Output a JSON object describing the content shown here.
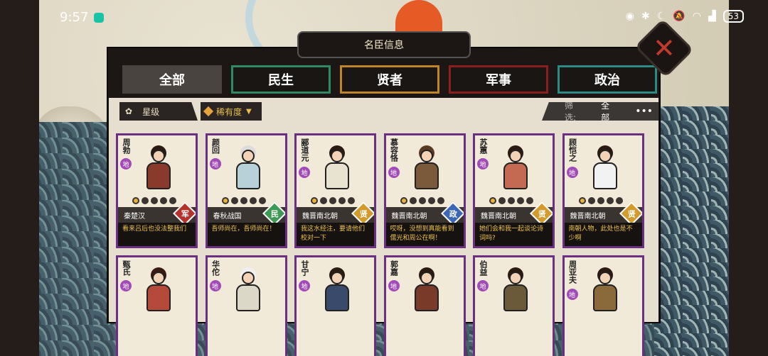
{
  "status_bar": {
    "time": "9:57",
    "battery": "53"
  },
  "window": {
    "title": "名臣信息"
  },
  "tabs": [
    {
      "label": "全部",
      "active": true
    },
    {
      "label": "民生"
    },
    {
      "label": "贤者"
    },
    {
      "label": "军事"
    },
    {
      "label": "政治"
    }
  ],
  "filters": {
    "star_label": "星级",
    "rarity_label": "稀有度",
    "screen_label": "筛选:",
    "screen_value": "全部",
    "more": "•••"
  },
  "cards": [
    {
      "name": "周勃",
      "tier": "地",
      "era": "秦楚汉",
      "category": "军",
      "cat_type": "mil",
      "stars": 5,
      "stars_on": 1,
      "quote": "看来吕后也没法整我们",
      "colors": {
        "body": "#8a3a2b",
        "hair": "#2a1a12"
      }
    },
    {
      "name": "颜回",
      "tier": "地",
      "era": "春秋战国",
      "category": "民",
      "cat_type": "min",
      "stars": 5,
      "stars_on": 1,
      "quote": "吾师尚在，吾师尚在！",
      "colors": {
        "body": "#b8d0d8",
        "hair": "#dcdcdc"
      }
    },
    {
      "name": "郦道元",
      "tier": "地",
      "era": "魏晋南北朝",
      "category": "贤",
      "cat_type": "sage",
      "stars": 5,
      "stars_on": 1,
      "quote": "我这水经注，要请他们校对一下",
      "colors": {
        "body": "#e8e2d0",
        "hair": "#2a1a12"
      }
    },
    {
      "name": "慕容恪",
      "tier": "地",
      "era": "魏晋南北朝",
      "category": "政",
      "cat_type": "pol",
      "stars": 5,
      "stars_on": 1,
      "quote": "哎呀，没想到真能看到儒光和周公在啊！",
      "colors": {
        "body": "#7a5a3a",
        "hair": "#5a3a22"
      }
    },
    {
      "name": "苏蕙",
      "tier": "地",
      "era": "魏晋南北朝",
      "category": "贤",
      "cat_type": "sage",
      "stars": 5,
      "stars_on": 1,
      "quote": "她们会和我一起谈论诗词吗?",
      "colors": {
        "body": "#c46a52",
        "hair": "#2a1a12"
      }
    },
    {
      "name": "顾恺之",
      "tier": "地",
      "era": "魏晋南北朝",
      "category": "贤",
      "cat_type": "sage",
      "stars": 5,
      "stars_on": 1,
      "quote": "南朝人物，此处也是不少啊",
      "colors": {
        "body": "#f2f2f2",
        "hair": "#2a1a12"
      }
    },
    {
      "name": "甄氏",
      "tier": "地",
      "colors": {
        "body": "#b54a3a",
        "hair": "#3a1a12"
      }
    },
    {
      "name": "华佗",
      "tier": "地",
      "colors": {
        "body": "#dcd8c8",
        "hair": "#f0f0f0"
      }
    },
    {
      "name": "甘宁",
      "tier": "地",
      "colors": {
        "body": "#3a4a6a",
        "hair": "#2a1a12"
      }
    },
    {
      "name": "郭嘉",
      "tier": "地",
      "colors": {
        "body": "#7a3a2a",
        "hair": "#2a1a12"
      }
    },
    {
      "name": "伯益",
      "tier": "地",
      "colors": {
        "body": "#6a5a3a",
        "hair": "#2a1a12"
      }
    },
    {
      "name": "周亚夫",
      "tier": "地",
      "colors": {
        "body": "#8a6a3a",
        "hair": "#2a1a12"
      }
    }
  ]
}
